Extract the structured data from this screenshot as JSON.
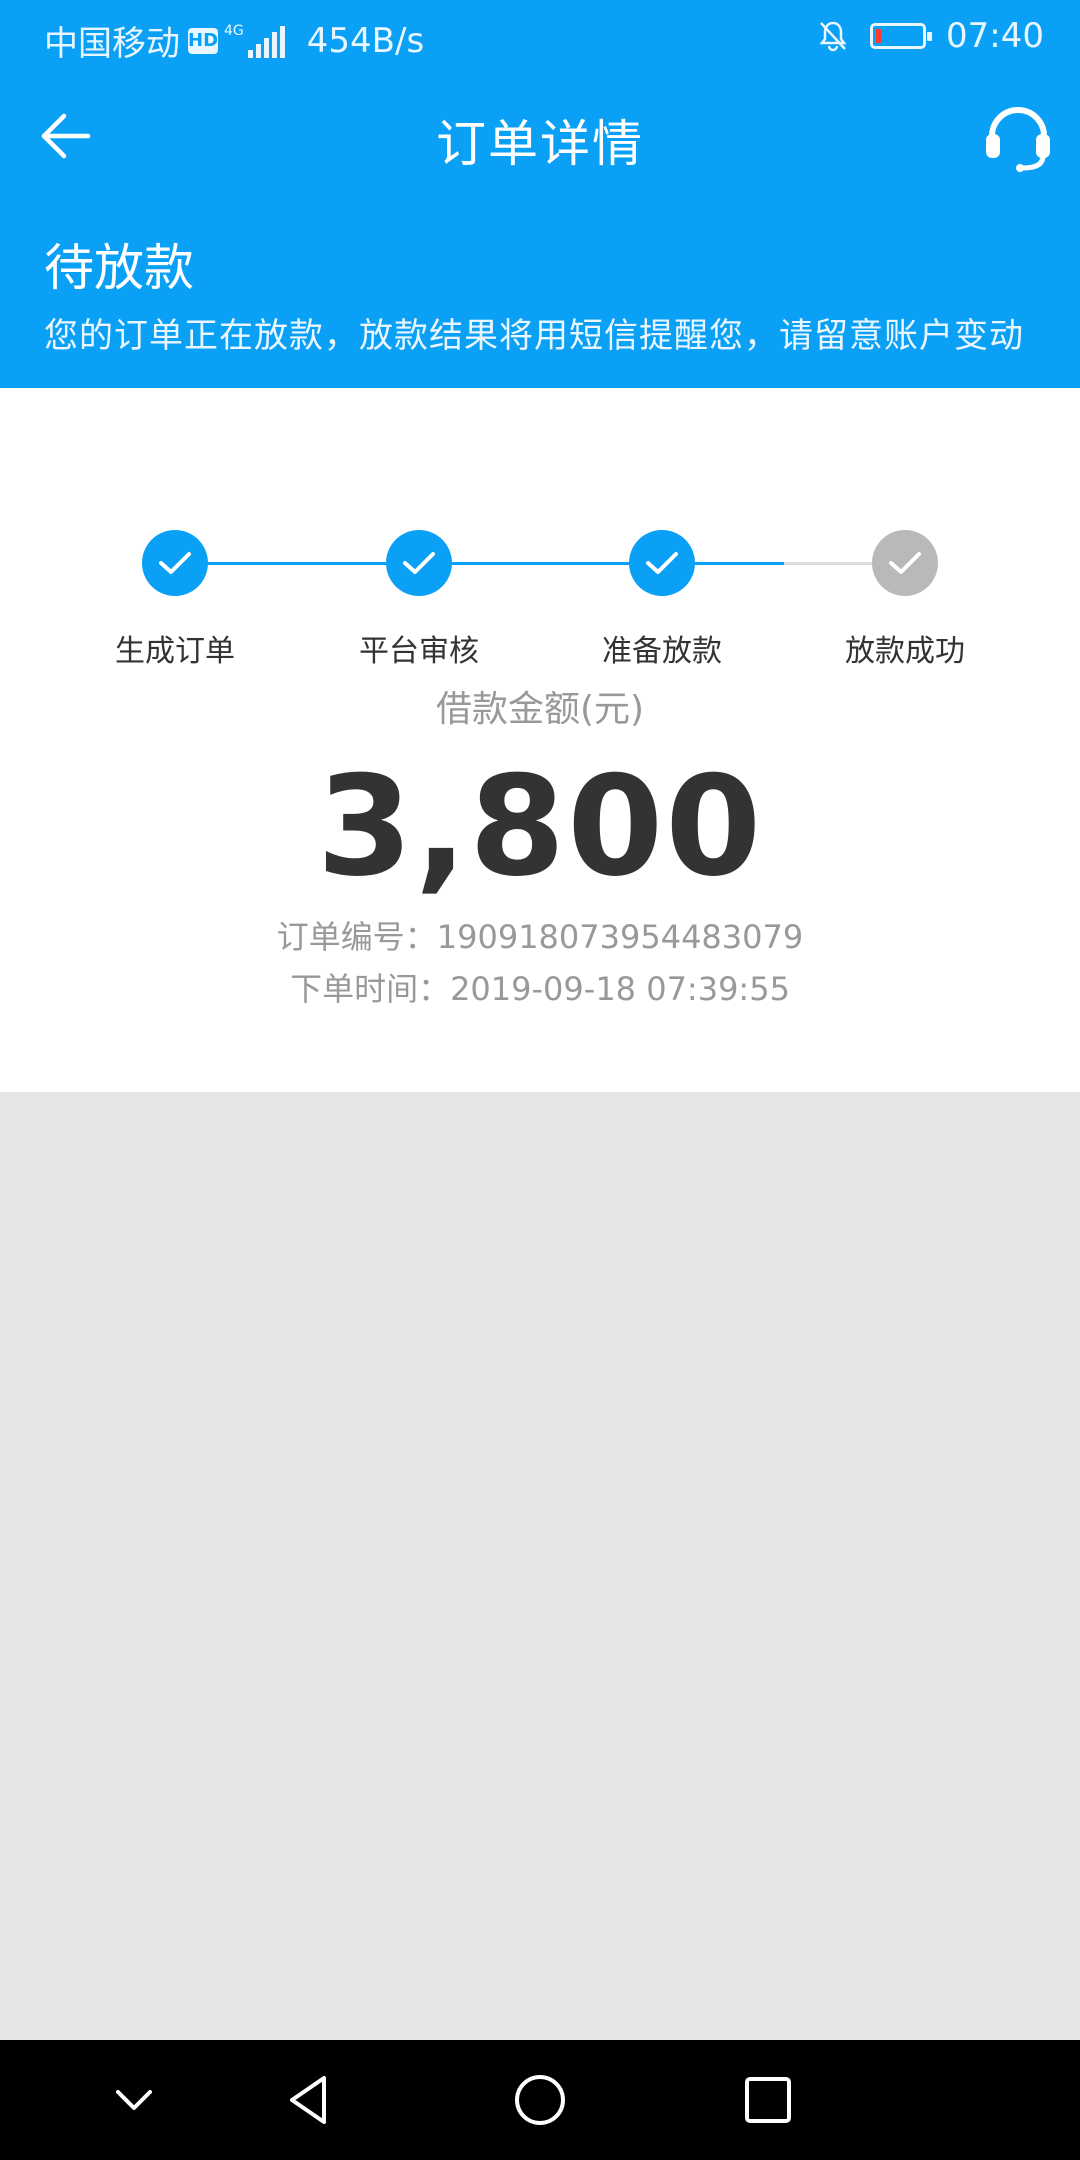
{
  "status_bar": {
    "carrier": "中国移动",
    "hd": "HD",
    "network": "4G",
    "speed": "454B/s",
    "time": "07:40",
    "battery_level_pct": 8
  },
  "header": {
    "title": "订单详情",
    "back_icon": "arrow-left-icon",
    "service_icon": "headset-icon"
  },
  "order_state": {
    "title": "待放款",
    "description": "您的订单正在放款，放款结果将用短信提醒您，请留意账户变动"
  },
  "steps": [
    {
      "label": "生成订单",
      "done": true
    },
    {
      "label": "平台审核",
      "done": true
    },
    {
      "label": "准备放款",
      "done": true
    },
    {
      "label": "放款成功",
      "done": false
    }
  ],
  "loan": {
    "amount_label": "借款金额(元)",
    "amount": "3,800",
    "order_no": "订单编号：19091807395448307​9",
    "order_time": "下单时间：2019-09-18 07:39:55"
  },
  "system_nav": {
    "icons": [
      "chevron-down-icon",
      "back-triangle-icon",
      "home-circle-icon",
      "recents-square-icon"
    ]
  },
  "colors": {
    "accent": "#0aa0f5",
    "inactive": "#b9b9b9",
    "page_bg": "#e6e6e6"
  }
}
